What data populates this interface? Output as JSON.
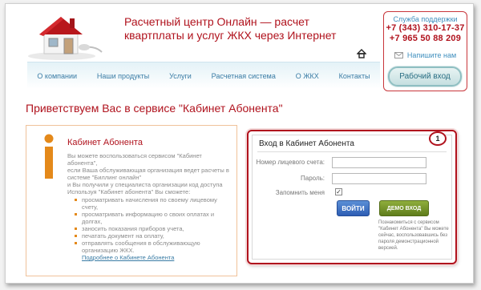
{
  "header": {
    "site_title": "Расчетный центр Онлайн — расчет квартплаты и услуг ЖКХ через Интернет",
    "home_icon": "home-icon"
  },
  "support": {
    "label": "Служба поддержки",
    "phones": [
      "+7 (343) 310-17-37",
      "+7 965 50 88 209"
    ],
    "write_us": "Напишите нам",
    "write_icon": "mail-icon"
  },
  "login_button": "Рабочий вход",
  "nav": {
    "items": [
      "О компании",
      "Наши продукты",
      "Услуги",
      "Расчетная система",
      "О ЖКХ",
      "Контакты"
    ]
  },
  "welcome": "Приветствуем Вас в сервисе \"Кабинет Абонента\"",
  "info": {
    "title": "Кабинет Абонента",
    "text_lines": [
      "Вы можете воспользоваться сервисом \"Кабинет абонента\",",
      "если Ваша обслуживающая организация ведет расчеты в системе \"Биллинг онлайн\"",
      "и Вы получили у специалиста организации код доступа",
      "Используя \"Кабинет абонента\" Вы сможете:"
    ],
    "items": [
      "просматривать начисления по своему лицевому счету,",
      "просматривать информацию о своих оплатах и долгах,",
      "заносить показания приборов учета,",
      "печатать документ на оплату,",
      "отправлять сообщения в обслуживающую организацию ЖКХ."
    ],
    "more_link": "Подробнее о Кабинете Абонента"
  },
  "login_form": {
    "title": "Вход в Кабинет Абонента",
    "account_label": "Номер лицевого счета:",
    "account_value": "",
    "password_label": "Пароль:",
    "password_value": "",
    "remember_label": "Запомнить меня",
    "remember_checked": true,
    "enter_button": "ВОЙТИ",
    "demo_button": "ДЕМО ВХОД",
    "demo_description": "Познакомиться с сервисом \"Кабинет Абонента\" Вы можете сейчас, воспользовавшись без пароля демонстрационной версией."
  },
  "callout_number": "1",
  "colors": {
    "accent_red": "#b0121d",
    "link_blue": "#3a7ca5",
    "enter_blue": "#2d5db4",
    "demo_green": "#6f8d24",
    "info_orange": "#e4891a"
  }
}
